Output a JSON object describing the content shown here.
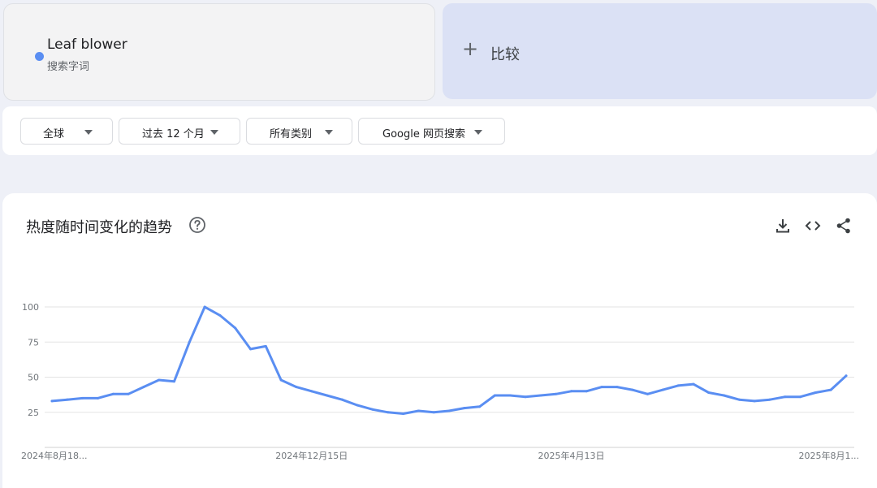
{
  "term": {
    "name": "Leaf blower",
    "type": "搜索字词",
    "color": "#5a8ef2"
  },
  "compare": {
    "plus": "+",
    "label": "比较"
  },
  "filters": [
    {
      "label": "全球"
    },
    {
      "label": "过去 12 个月"
    },
    {
      "label": "所有类别"
    },
    {
      "label": "Google 网页搜索"
    }
  ],
  "card": {
    "title": "热度随时间变化的趋势",
    "help_icon": "help-circle-icon",
    "tools": [
      "download-icon",
      "embed-code-icon",
      "share-icon"
    ]
  },
  "chart_data": {
    "type": "line",
    "title": "热度随时间变化的趋势",
    "xlabel": "",
    "ylabel": "",
    "ylim": [
      0,
      100
    ],
    "yticks": [
      100,
      75,
      50,
      25
    ],
    "grid": true,
    "legend": "none",
    "x_tick_labels": [
      "2024年8月18...",
      "2024年12月15日",
      "2025年4月13日",
      "2025年8月1..."
    ],
    "x_tick_indices": [
      0,
      17,
      34,
      51
    ],
    "series": [
      {
        "name": "Leaf blower",
        "color": "#5a8ef2",
        "values": [
          33,
          34,
          35,
          35,
          38,
          38,
          43,
          48,
          47,
          75,
          100,
          94,
          85,
          70,
          72,
          48,
          43,
          40,
          37,
          34,
          30,
          27,
          25,
          24,
          26,
          25,
          26,
          28,
          29,
          37,
          37,
          36,
          37,
          38,
          40,
          40,
          43,
          43,
          41,
          38,
          41,
          44,
          45,
          39,
          37,
          34,
          33,
          34,
          36,
          36,
          39,
          41,
          51
        ]
      }
    ]
  }
}
